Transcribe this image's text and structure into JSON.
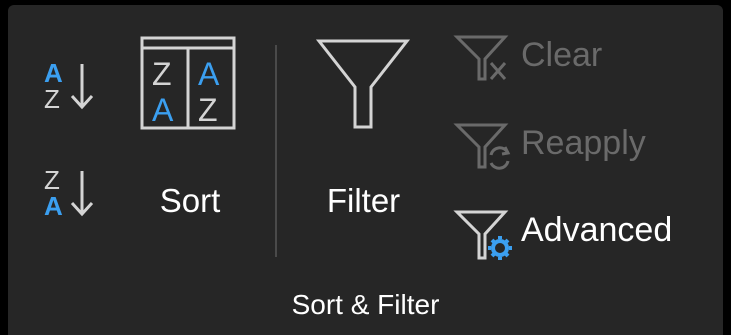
{
  "ribbon_group": {
    "label": "Sort & Filter",
    "sort_az": {
      "icon_top": "A",
      "icon_bottom": "Z",
      "icon": "sort-ascending-icon"
    },
    "sort_za": {
      "icon_top": "Z",
      "icon_bottom": "A",
      "icon": "sort-descending-icon"
    },
    "sort": {
      "label": "Sort",
      "icon": "custom-sort-icon",
      "glyphs": [
        "Z",
        "A",
        "A",
        "Z"
      ]
    },
    "filter": {
      "label": "Filter",
      "icon": "funnel-icon"
    },
    "clear": {
      "label": "Clear",
      "icon": "clear-filter-icon",
      "enabled": false
    },
    "reapply": {
      "label": "Reapply",
      "icon": "reapply-filter-icon",
      "enabled": false
    },
    "advanced": {
      "label": "Advanced",
      "icon": "advanced-filter-icon",
      "enabled": true
    }
  },
  "colors": {
    "background": "#262626",
    "text": "#ffffff",
    "disabled_text": "#6a6a6a",
    "accent_blue": "#3b9ff0",
    "icon_gray": "#d4d4d4"
  }
}
